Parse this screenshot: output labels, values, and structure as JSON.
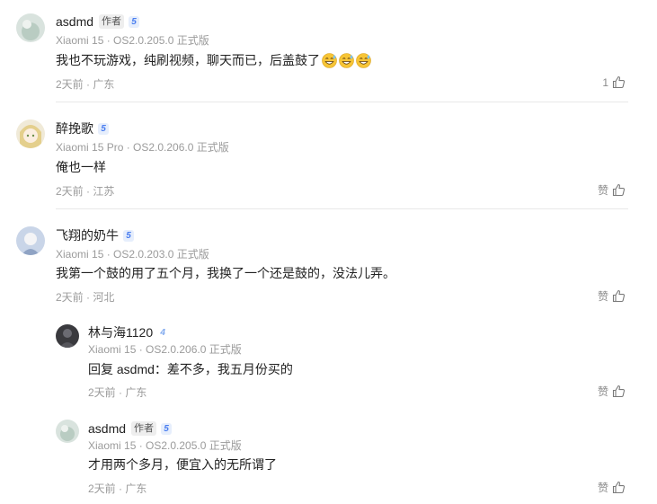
{
  "comments": [
    {
      "username": "asdmd",
      "author_tag": "作者",
      "level": "5",
      "device": "Xiaomi 15 · OS2.0.205.0 正式版",
      "text": "我也不玩游戏，纯刷视频，聊天而已，后盖鼓了",
      "emoji": "grinning-sweat-face x3",
      "time_location": "2天前 · 广东",
      "like_count": "1",
      "colors": {
        "avatar": "#c8d6cf"
      }
    },
    {
      "username": "醉挽歌",
      "level": "5",
      "device": "Xiaomi 15 Pro · OS2.0.206.0 正式版",
      "text": "俺也一样",
      "time_location": "2天前 · 江苏",
      "like_label": "赞",
      "colors": {
        "avatar": "#e9e0c8"
      }
    },
    {
      "username": "飞翔的奶牛",
      "level": "5",
      "device": "Xiaomi 15 · OS2.0.203.0 正式版",
      "text": "我第一个鼓的用了五个月，我换了一个还是鼓的，没法儿弄。",
      "time_location": "2天前 · 河北",
      "like_label": "赞",
      "colors": {
        "avatar": "#aebfd8"
      },
      "replies": [
        {
          "username": "林与海1120",
          "level": "4",
          "device": "Xiaomi 15 · OS2.0.206.0 正式版",
          "text": "回复 asdmd：差不多，我五月份买的",
          "time_location": "2天前 · 广东",
          "like_label": "赞",
          "colors": {
            "avatar": "#3a3a3e"
          }
        },
        {
          "username": "asdmd",
          "author_tag": "作者",
          "level": "5",
          "device": "Xiaomi 15 · OS2.0.205.0 正式版",
          "text": "才用两个多月，便宜入的无所谓了",
          "time_location": "2天前 · 广东",
          "like_label": "赞",
          "colors": {
            "avatar": "#c8d6cf"
          }
        }
      ]
    }
  ],
  "icons": {
    "like": "thumbs-up-icon",
    "level": "level-badge",
    "emoji": "grinning-sweat-emoji"
  }
}
